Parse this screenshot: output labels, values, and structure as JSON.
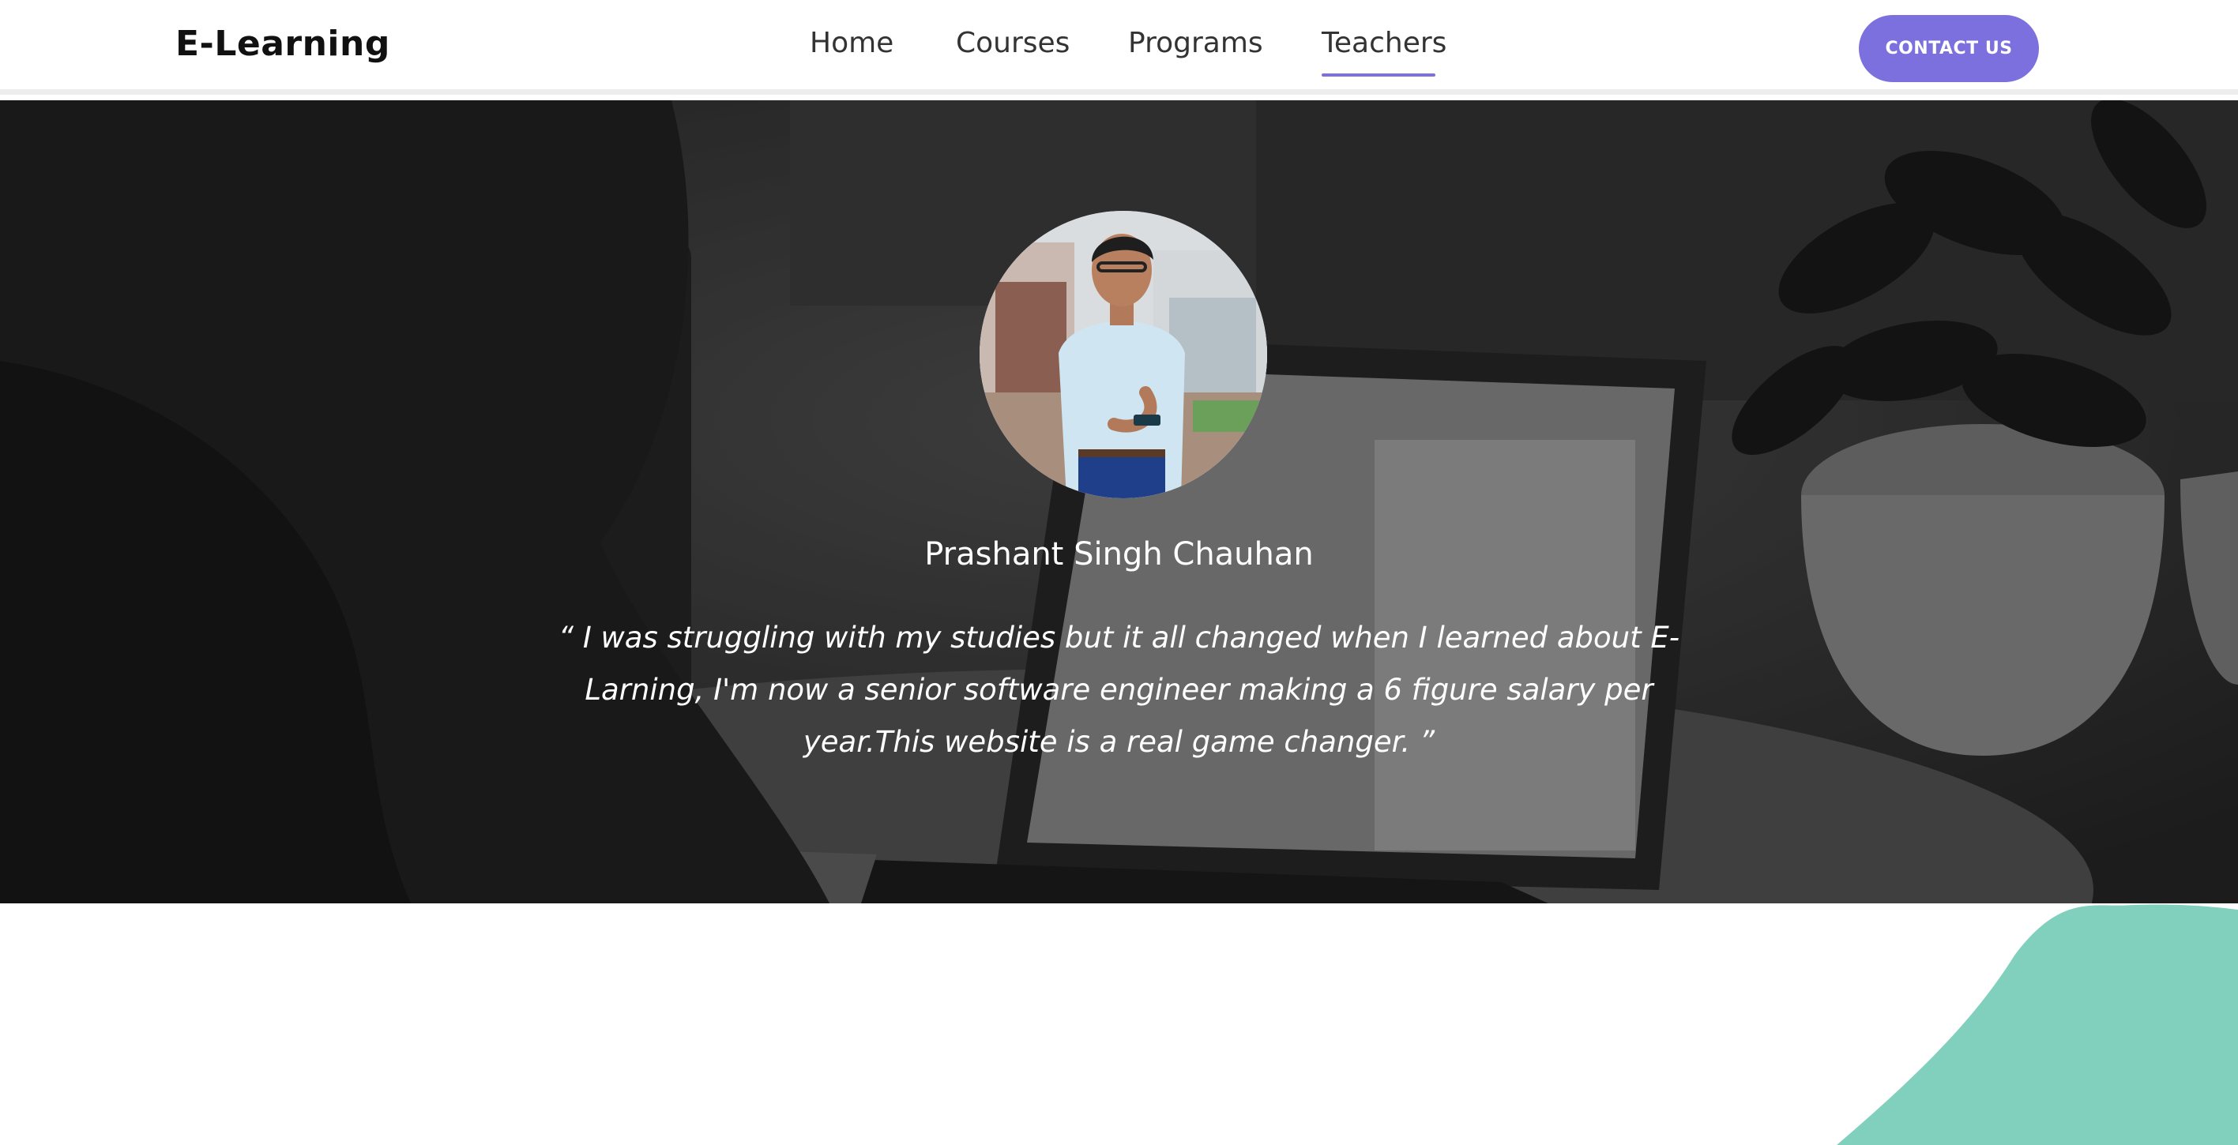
{
  "navbar": {
    "brand": "E-Learning",
    "links": [
      {
        "label": "Home"
      },
      {
        "label": "Courses"
      },
      {
        "label": "Programs"
      },
      {
        "label": "Teachers",
        "active": true
      }
    ],
    "contact_label": "CONTACT US"
  },
  "testimonial": {
    "name": "Prashant Singh Chauhan",
    "quote": "“ I was struggling with my studies but it all changed when I learned about E-Larning, I'm now a senior software engineer making a 6 figure salary per year.This website is a real game changer. ”"
  },
  "colors": {
    "accent": "#7b70dd",
    "teal_blob": "#80d0bd",
    "text_dark": "#111111",
    "hero_text": "#ffffff"
  }
}
